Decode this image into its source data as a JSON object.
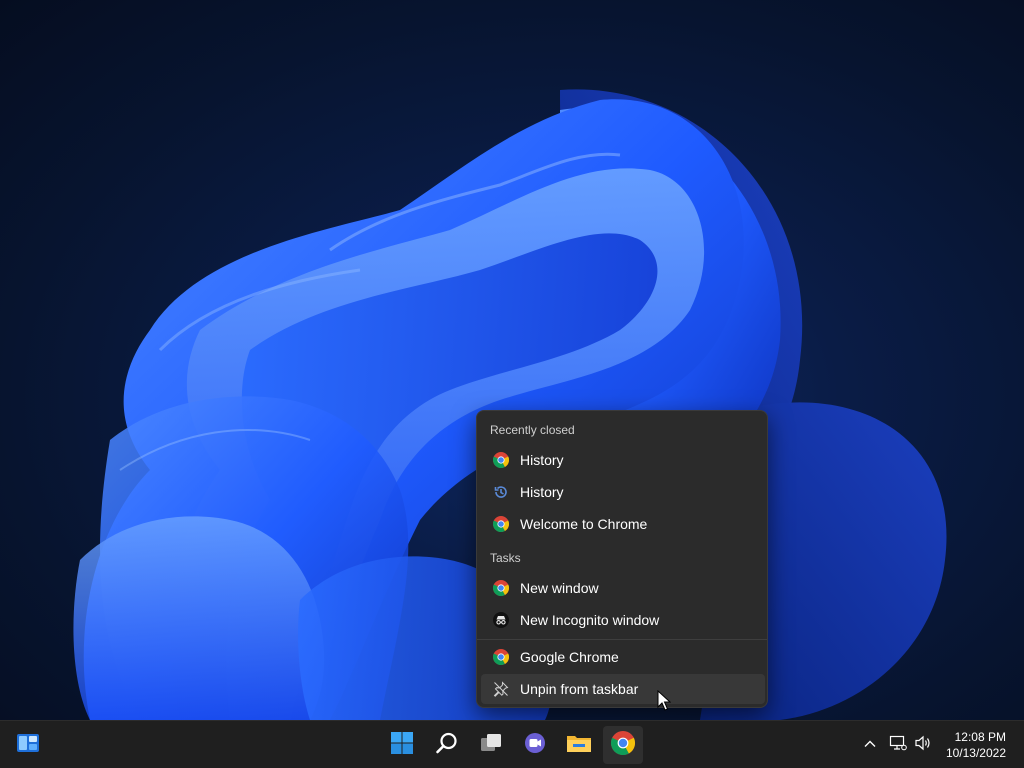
{
  "jumplist": {
    "recently_closed_header": "Recently closed",
    "recently_closed": [
      {
        "label": "History",
        "icon": "chrome-icon"
      },
      {
        "label": "History",
        "icon": "history-clock-icon"
      },
      {
        "label": "Welcome to Chrome",
        "icon": "chrome-icon"
      }
    ],
    "tasks_header": "Tasks",
    "tasks": [
      {
        "label": "New window",
        "icon": "chrome-icon"
      },
      {
        "label": "New Incognito window",
        "icon": "incognito-icon"
      }
    ],
    "app_item": {
      "label": "Google Chrome",
      "icon": "chrome-icon"
    },
    "unpin_item": {
      "label": "Unpin from taskbar",
      "icon": "unpin-icon"
    }
  },
  "taskbar": {
    "apps": [
      {
        "name": "widgets",
        "icon": "widgets-icon"
      },
      {
        "name": "start",
        "icon": "windows-start-icon"
      },
      {
        "name": "search",
        "icon": "search-icon"
      },
      {
        "name": "task-view",
        "icon": "task-view-icon"
      },
      {
        "name": "teams-chat",
        "icon": "chat-icon"
      },
      {
        "name": "file-explorer",
        "icon": "folder-icon"
      },
      {
        "name": "chrome",
        "icon": "chrome-icon"
      }
    ],
    "clock": {
      "time": "12:08 PM",
      "date": "10/13/2022"
    }
  },
  "colors": {
    "menu_bg": "#2b2b2b",
    "taskbar_bg": "#1f1f1f",
    "accent": "#60cdff"
  }
}
